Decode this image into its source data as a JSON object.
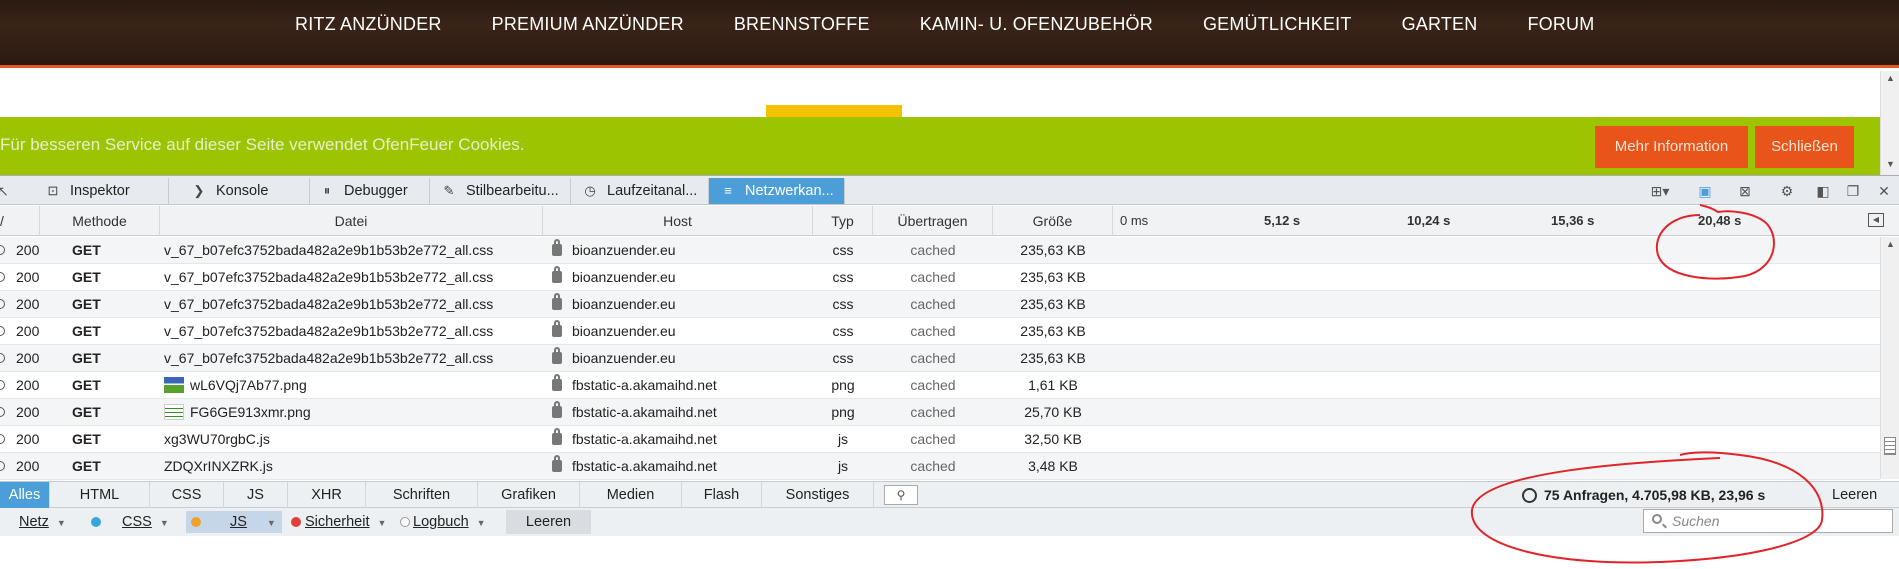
{
  "site": {
    "nav": [
      "RITZ ANZÜNDER",
      "PREMIUM ANZÜNDER",
      "BRENNSTOFFE",
      "KAMIN- U. OFENZUBEHÖR",
      "GEMÜTLICHKEIT",
      "GARTEN",
      "FORUM"
    ],
    "cookie_text": "Für besseren Service auf dieser Seite verwendet OfenFeuer Cookies.",
    "more_info_label": "Mehr Information",
    "close_label": "Schließen",
    "colors": {
      "header": "#2a1a14",
      "accent": "#e8541a",
      "cookie_bar": "#9cc400",
      "tab_highlight": "#f6c200"
    }
  },
  "devtools": {
    "tabs": [
      {
        "label": "Inspektor",
        "icon": "inspector-icon"
      },
      {
        "label": "Konsole",
        "icon": "console-icon"
      },
      {
        "label": "Debugger",
        "icon": "debugger-icon"
      },
      {
        "label": "Stilbearbeitu...",
        "icon": "style-editor-icon"
      },
      {
        "label": "Laufzeitanal...",
        "icon": "performance-icon"
      },
      {
        "label": "Netzwerkan...",
        "icon": "network-icon",
        "active": true
      }
    ],
    "active_color": "#4c9ed9"
  },
  "network": {
    "columns": {
      "method": "Methode",
      "file": "Datei",
      "host": "Host",
      "type": "Typ",
      "transferred": "Übertragen",
      "size": "Größe"
    },
    "ticks": [
      "0 ms",
      "5,12 s",
      "10,24 s",
      "15,36 s",
      "20,48 s"
    ],
    "rows": [
      {
        "status": "200",
        "method": "GET",
        "file": "v_67_b07efc3752bada482a2e9b1b53b2e772_all.css",
        "thumb": "",
        "host": "bioanzuender.eu",
        "type": "css",
        "transferred": "cached",
        "size": "235,63 KB"
      },
      {
        "status": "200",
        "method": "GET",
        "file": "v_67_b07efc3752bada482a2e9b1b53b2e772_all.css",
        "thumb": "",
        "host": "bioanzuender.eu",
        "type": "css",
        "transferred": "cached",
        "size": "235,63 KB"
      },
      {
        "status": "200",
        "method": "GET",
        "file": "v_67_b07efc3752bada482a2e9b1b53b2e772_all.css",
        "thumb": "",
        "host": "bioanzuender.eu",
        "type": "css",
        "transferred": "cached",
        "size": "235,63 KB"
      },
      {
        "status": "200",
        "method": "GET",
        "file": "v_67_b07efc3752bada482a2e9b1b53b2e772_all.css",
        "thumb": "",
        "host": "bioanzuender.eu",
        "type": "css",
        "transferred": "cached",
        "size": "235,63 KB"
      },
      {
        "status": "200",
        "method": "GET",
        "file": "v_67_b07efc3752bada482a2e9b1b53b2e772_all.css",
        "thumb": "",
        "host": "bioanzuender.eu",
        "type": "css",
        "transferred": "cached",
        "size": "235,63 KB"
      },
      {
        "status": "200",
        "method": "GET",
        "file": "wL6VQj7Ab77.png",
        "thumb": "blue",
        "host": "fbstatic-a.akamaihd.net",
        "type": "png",
        "transferred": "cached",
        "size": "1,61 KB"
      },
      {
        "status": "200",
        "method": "GET",
        "file": "FG6GE913xmr.png",
        "thumb": "lines",
        "host": "fbstatic-a.akamaihd.net",
        "type": "png",
        "transferred": "cached",
        "size": "25,70 KB"
      },
      {
        "status": "200",
        "method": "GET",
        "file": "xg3WU70rgbC.js",
        "thumb": "",
        "host": "fbstatic-a.akamaihd.net",
        "type": "js",
        "transferred": "cached",
        "size": "32,50 KB"
      },
      {
        "status": "200",
        "method": "GET",
        "file": "ZDQXrINXZRK.js",
        "thumb": "",
        "host": "fbstatic-a.akamaihd.net",
        "type": "js",
        "transferred": "cached",
        "size": "3,48 KB"
      }
    ],
    "filters": [
      "Alles",
      "HTML",
      "CSS",
      "JS",
      "XHR",
      "Schriften",
      "Grafiken",
      "Medien",
      "Flash",
      "Sonstiges"
    ],
    "summary": "75 Anfragen, 4.705,98 KB, 23,96 s",
    "clear_label": "Leeren"
  },
  "console": {
    "filters": [
      {
        "label": "Netz",
        "dot": ""
      },
      {
        "label": "CSS",
        "dot": "#35a8d8"
      },
      {
        "label": "JS",
        "dot": "#f0a030"
      },
      {
        "label": "Sicherheit",
        "dot": "#e0403a"
      },
      {
        "label": "Logbuch",
        "dot": ""
      }
    ],
    "clear_label": "Leeren",
    "search_placeholder": "Suchen"
  }
}
